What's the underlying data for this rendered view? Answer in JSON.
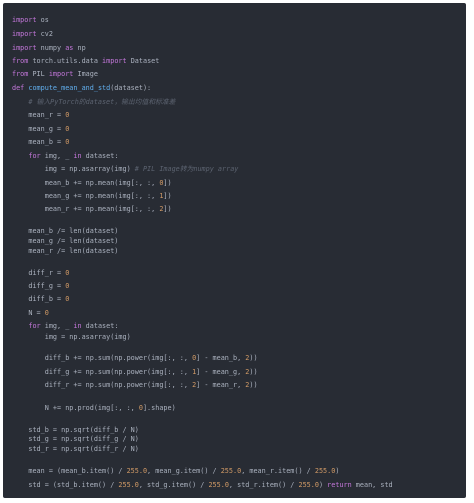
{
  "colors": {
    "background": "#282c34",
    "keyword": "#c678dd",
    "function": "#61afef",
    "number": "#d19a66",
    "comment": "#5c6370",
    "plain": "#abb2bf"
  },
  "code": {
    "lines": [
      [
        {
          "t": "import",
          "c": "kw"
        },
        {
          "t": " os",
          "c": "pl"
        }
      ],
      [
        {
          "t": "import",
          "c": "kw"
        },
        {
          "t": " cv2",
          "c": "pl"
        }
      ],
      [
        {
          "t": "import",
          "c": "kw"
        },
        {
          "t": " numpy ",
          "c": "pl"
        },
        {
          "t": "as",
          "c": "kw"
        },
        {
          "t": " np",
          "c": "pl"
        }
      ],
      [
        {
          "t": "from",
          "c": "kw"
        },
        {
          "t": " torch.utils.data ",
          "c": "pl"
        },
        {
          "t": "import",
          "c": "kw"
        },
        {
          "t": " Dataset",
          "c": "pl"
        }
      ],
      [
        {
          "t": "from",
          "c": "kw"
        },
        {
          "t": " PIL ",
          "c": "pl"
        },
        {
          "t": "import",
          "c": "kw"
        },
        {
          "t": " Image",
          "c": "pl"
        }
      ],
      [
        {
          "t": "def",
          "c": "kw"
        },
        {
          "t": " ",
          "c": "pl"
        },
        {
          "t": "compute_mean_and_std",
          "c": "fn"
        },
        {
          "t": "(dataset):",
          "c": "pl"
        }
      ],
      [
        {
          "t": "    # 输入PyTorch的dataset，输出均值和标准差",
          "c": "cm"
        }
      ],
      [
        {
          "t": "    mean_r = ",
          "c": "pl"
        },
        {
          "t": "0",
          "c": "num"
        }
      ],
      [
        {
          "t": "    mean_g = ",
          "c": "pl"
        },
        {
          "t": "0",
          "c": "num"
        }
      ],
      [
        {
          "t": "    mean_b = ",
          "c": "pl"
        },
        {
          "t": "0",
          "c": "num"
        }
      ],
      [
        {
          "t": "    ",
          "c": "pl"
        },
        {
          "t": "for",
          "c": "kw"
        },
        {
          "t": " img, _ ",
          "c": "pl"
        },
        {
          "t": "in",
          "c": "kw"
        },
        {
          "t": " dataset:",
          "c": "pl"
        }
      ],
      [
        {
          "t": "        img = np.asarray(img) ",
          "c": "pl"
        },
        {
          "t": "# PIL Image转为numpy array",
          "c": "cm"
        }
      ],
      [
        {
          "t": "        mean_b += np.mean(img[:, :, ",
          "c": "pl"
        },
        {
          "t": "0",
          "c": "num"
        },
        {
          "t": "])",
          "c": "pl"
        }
      ],
      [
        {
          "t": "        mean_g += np.mean(img[:, :, ",
          "c": "pl"
        },
        {
          "t": "1",
          "c": "num"
        },
        {
          "t": "])",
          "c": "pl"
        }
      ],
      [
        {
          "t": "        mean_r += np.mean(img[:, :, ",
          "c": "pl"
        },
        {
          "t": "2",
          "c": "num"
        },
        {
          "t": "])",
          "c": "pl"
        }
      ],
      [
        {
          "t": "    mean_b /= len(dataset)",
          "c": "pl"
        }
      ],
      [
        {
          "t": "    mean_g /= len(dataset)",
          "c": "pl"
        }
      ],
      [
        {
          "t": "    mean_r /= len(dataset)",
          "c": "pl"
        }
      ],
      [
        {
          "t": "    diff_r = ",
          "c": "pl"
        },
        {
          "t": "0",
          "c": "num"
        }
      ],
      [
        {
          "t": "    diff_g = ",
          "c": "pl"
        },
        {
          "t": "0",
          "c": "num"
        }
      ],
      [
        {
          "t": "    diff_b = ",
          "c": "pl"
        },
        {
          "t": "0",
          "c": "num"
        }
      ],
      [
        {
          "t": "    N = ",
          "c": "pl"
        },
        {
          "t": "0",
          "c": "num"
        }
      ],
      [
        {
          "t": "    ",
          "c": "pl"
        },
        {
          "t": "for",
          "c": "kw"
        },
        {
          "t": " img, _ ",
          "c": "pl"
        },
        {
          "t": "in",
          "c": "kw"
        },
        {
          "t": " dataset:",
          "c": "pl"
        }
      ],
      [
        {
          "t": "        img = np.asarray(img)",
          "c": "pl"
        }
      ],
      [
        {
          "t": "        diff_b += np.sum(np.power(img[:, :, ",
          "c": "pl"
        },
        {
          "t": "0",
          "c": "num"
        },
        {
          "t": "] - mean_b, ",
          "c": "pl"
        },
        {
          "t": "2",
          "c": "num"
        },
        {
          "t": "))",
          "c": "pl"
        }
      ],
      [
        {
          "t": "        diff_g += np.sum(np.power(img[:, :, ",
          "c": "pl"
        },
        {
          "t": "1",
          "c": "num"
        },
        {
          "t": "] - mean_g, ",
          "c": "pl"
        },
        {
          "t": "2",
          "c": "num"
        },
        {
          "t": "))",
          "c": "pl"
        }
      ],
      [
        {
          "t": "        diff_r += np.sum(np.power(img[:, :, ",
          "c": "pl"
        },
        {
          "t": "2",
          "c": "num"
        },
        {
          "t": "] - mean_r, ",
          "c": "pl"
        },
        {
          "t": "2",
          "c": "num"
        },
        {
          "t": "))",
          "c": "pl"
        }
      ],
      [
        {
          "t": "        N += np.prod(img[:, :, ",
          "c": "pl"
        },
        {
          "t": "0",
          "c": "num"
        },
        {
          "t": "].shape)",
          "c": "pl"
        }
      ],
      [
        {
          "t": "    std_b = np.sqrt(diff_b / N)",
          "c": "pl"
        }
      ],
      [
        {
          "t": "    std_g = np.sqrt(diff_g / N)",
          "c": "pl"
        }
      ],
      [
        {
          "t": "    std_r = np.sqrt(diff_r / N)",
          "c": "pl"
        }
      ],
      [
        {
          "t": "    mean = (mean_b.item() / ",
          "c": "pl"
        },
        {
          "t": "255.0",
          "c": "num"
        },
        {
          "t": ", mean_g.item() / ",
          "c": "pl"
        },
        {
          "t": "255.0",
          "c": "num"
        },
        {
          "t": ", mean_r.item() / ",
          "c": "pl"
        },
        {
          "t": "255.0",
          "c": "num"
        },
        {
          "t": ")",
          "c": "pl"
        }
      ],
      [
        {
          "t": "    std = (std_b.item() / ",
          "c": "pl"
        },
        {
          "t": "255.0",
          "c": "num"
        },
        {
          "t": ", std_g.item() / ",
          "c": "pl"
        },
        {
          "t": "255.0",
          "c": "num"
        },
        {
          "t": ", std_r.item() / ",
          "c": "pl"
        },
        {
          "t": "255.0",
          "c": "num"
        },
        {
          "t": ") ",
          "c": "pl"
        },
        {
          "t": "return",
          "c": "kw"
        },
        {
          "t": " mean, std",
          "c": "pl"
        }
      ]
    ]
  }
}
